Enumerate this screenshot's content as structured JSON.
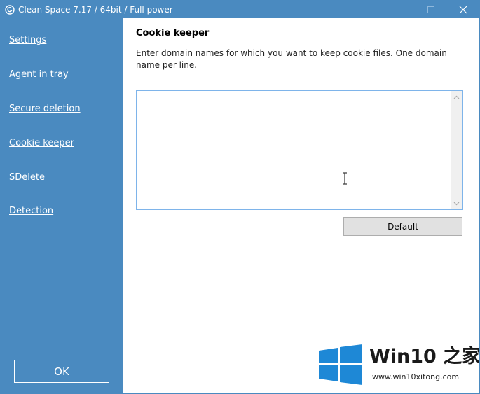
{
  "window": {
    "title": "Clean Space 7.17 / 64bit / Full power",
    "accent_color": "#4a8ac0",
    "icon": "clean-space-app-icon",
    "controls": {
      "minimize_icon": "minimize-icon",
      "maximize_icon": "maximize-icon",
      "close_icon": "close-icon"
    }
  },
  "sidebar": {
    "items": [
      {
        "label": "Settings"
      },
      {
        "label": "Agent in tray"
      },
      {
        "label": "Secure deletion"
      },
      {
        "label": "Cookie keeper"
      },
      {
        "label": "SDelete"
      },
      {
        "label": "Detection"
      }
    ],
    "ok_label": "OK"
  },
  "main": {
    "heading": "Cookie keeper",
    "description": "Enter domain names for which you want to keep cookie files. One domain name per line.",
    "domain_list_value": "",
    "default_label": "Default"
  },
  "watermark": {
    "brand": "Win10 之家",
    "url": "www.win10xitong.com",
    "logo_icon": "windows-logo-icon",
    "logo_color": "#1e88d6"
  }
}
